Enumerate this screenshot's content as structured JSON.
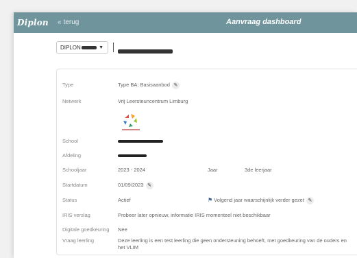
{
  "header": {
    "brand": "Diplon",
    "back_label": "terug",
    "title": "Aanvraag dashboard"
  },
  "selector": {
    "dossier_prefix": "DIPLON"
  },
  "details": {
    "type": {
      "label": "Type",
      "value": "Type BA: Basisaanbod"
    },
    "netwerk": {
      "label": "Netwerk",
      "value": "Vrij Leersteuncentrum Limburg"
    },
    "school": {
      "label": "School"
    },
    "afdeling": {
      "label": "Afdeling"
    },
    "schooljaar": {
      "label": "Schooljaar",
      "value": "2023 - 2024",
      "jaar_label": "Jaar",
      "jaar_value": "3de leerjaar"
    },
    "startdatum": {
      "label": "Startdatum",
      "value": "01/09/2023"
    },
    "status": {
      "label": "Status",
      "value": "Actief",
      "followup": "Volgend jaar waarschijnlijk verder gezet"
    },
    "iris": {
      "label": "IRIS verslag",
      "value": "Probeer later opnieuw, informatie IRIS momenteel niet beschikbaar"
    },
    "goedkeuring": {
      "label": "Digitale goedkeuring",
      "value": "Nee"
    },
    "vraag": {
      "label": "Vraag leerling",
      "value": "Deze leerling is een test leerling die geen ondersteuning behoeft, met goedkeuring van de ouders en het VLIM"
    }
  },
  "colors": {
    "topbar": "#6f949c",
    "flag": "#3d5b8f"
  },
  "icons": {
    "back": "chevron-left-double-icon",
    "edit": "pencil-icon",
    "flag": "flag-icon",
    "caret": "caret-down-icon"
  }
}
